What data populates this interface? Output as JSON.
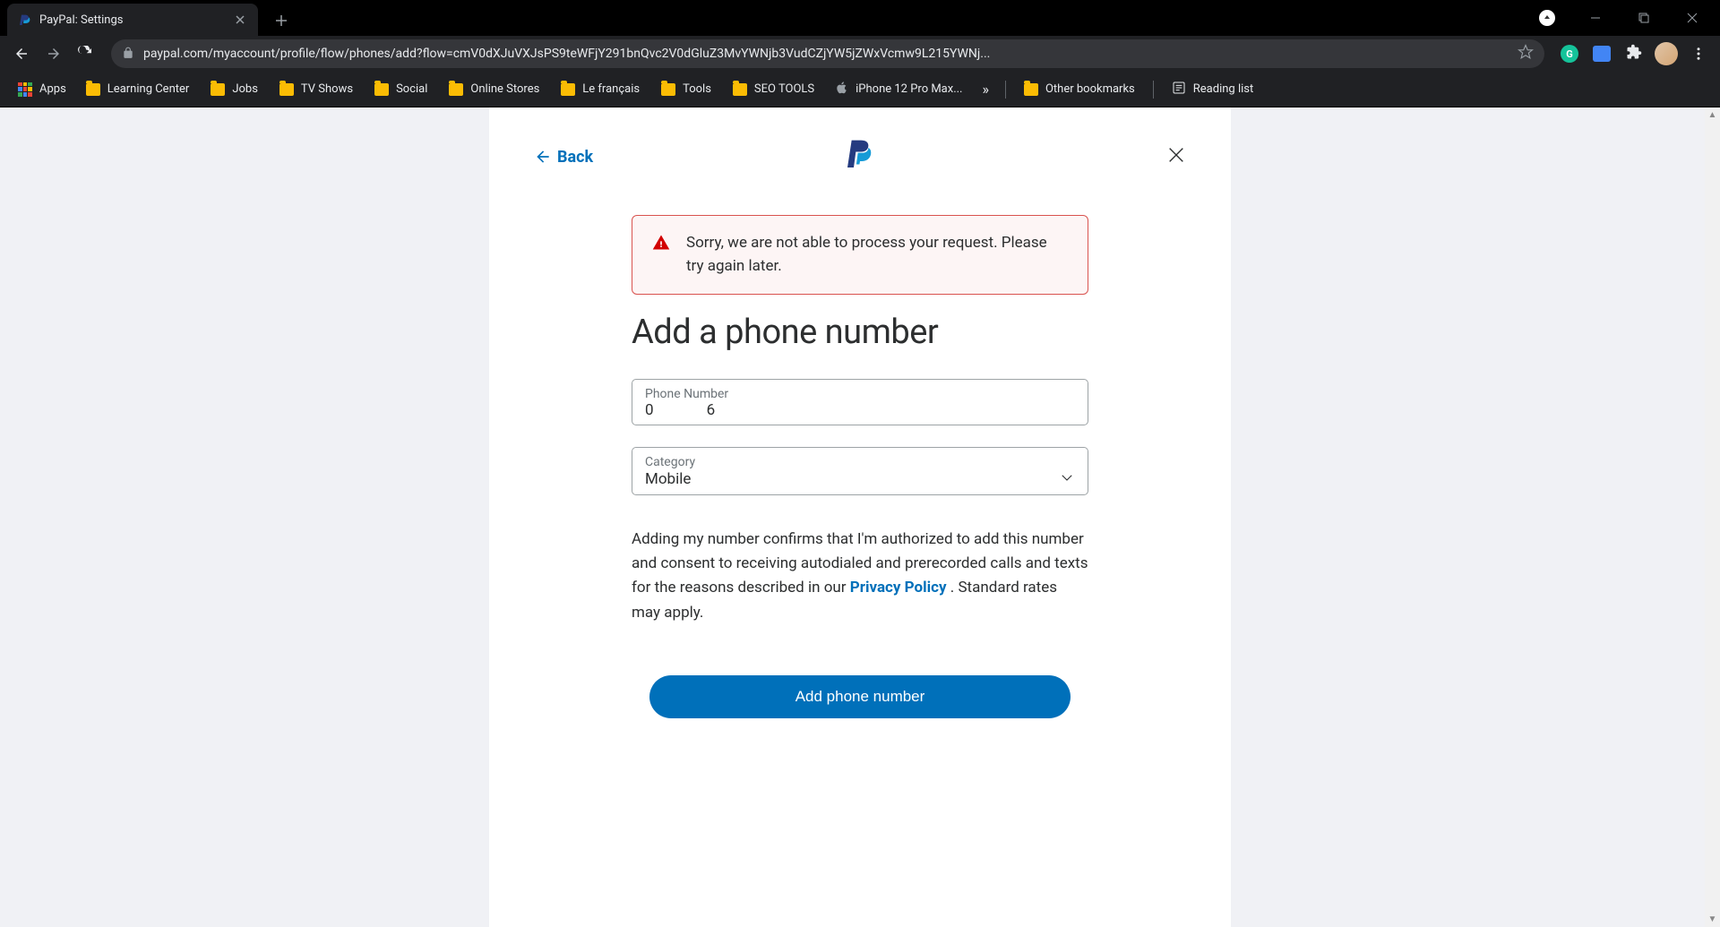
{
  "browser": {
    "tab_title": "PayPal: Settings",
    "url": "paypal.com/myaccount/profile/flow/phones/add?flow=cmV0dXJuVXJsPS9teWFjY291bnQvc2V0dGluZ3MvYWNjb3VudCZjYW5jZWxVcmw9L215YWNj...",
    "bookmarks": {
      "apps": "Apps",
      "items": [
        "Learning Center",
        "Jobs",
        "TV Shows",
        "Social",
        "Online Stores",
        "Le français",
        "Tools",
        "SEO TOOLS"
      ],
      "apple_item": "iPhone 12 Pro Max...",
      "overflow": "»",
      "other": "Other bookmarks",
      "reading_list": "Reading list"
    }
  },
  "page": {
    "back": "Back",
    "alert": "Sorry, we are not able to process your request. Please try again later.",
    "title": "Add a phone number",
    "phone": {
      "label": "Phone Number",
      "value": "0              6"
    },
    "category": {
      "label": "Category",
      "value": "Mobile"
    },
    "disclaimer_part1": "Adding my number confirms that I'm authorized to add this number and consent to receiving autodialed and prerecorded calls and texts for the reasons described in our ",
    "privacy_link": "Privacy Policy",
    "disclaimer_part2": " . Standard rates may apply.",
    "submit": "Add phone number"
  }
}
